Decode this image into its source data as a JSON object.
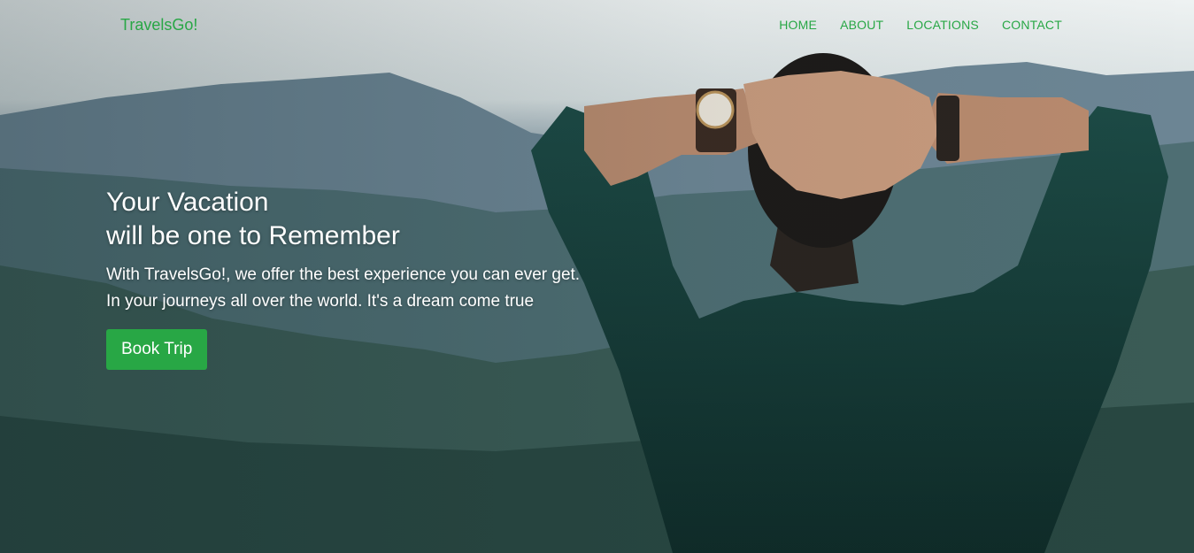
{
  "brand": {
    "name": "TravelsGo!"
  },
  "nav": {
    "items": [
      {
        "label": "HOME"
      },
      {
        "label": "ABOUT"
      },
      {
        "label": "LOCATIONS"
      },
      {
        "label": "CONTACT"
      }
    ]
  },
  "hero": {
    "title_line1": "Your Vacation",
    "title_line2": "will be one to Remember",
    "subtitle_line1": "With TravelsGo!, we offer the best experience you can ever get.",
    "subtitle_line2": "In your journeys all over the world. It's a dream come true",
    "cta_label": "Book Trip"
  },
  "colors": {
    "accent": "#28a745",
    "text_light": "#ffffff"
  }
}
